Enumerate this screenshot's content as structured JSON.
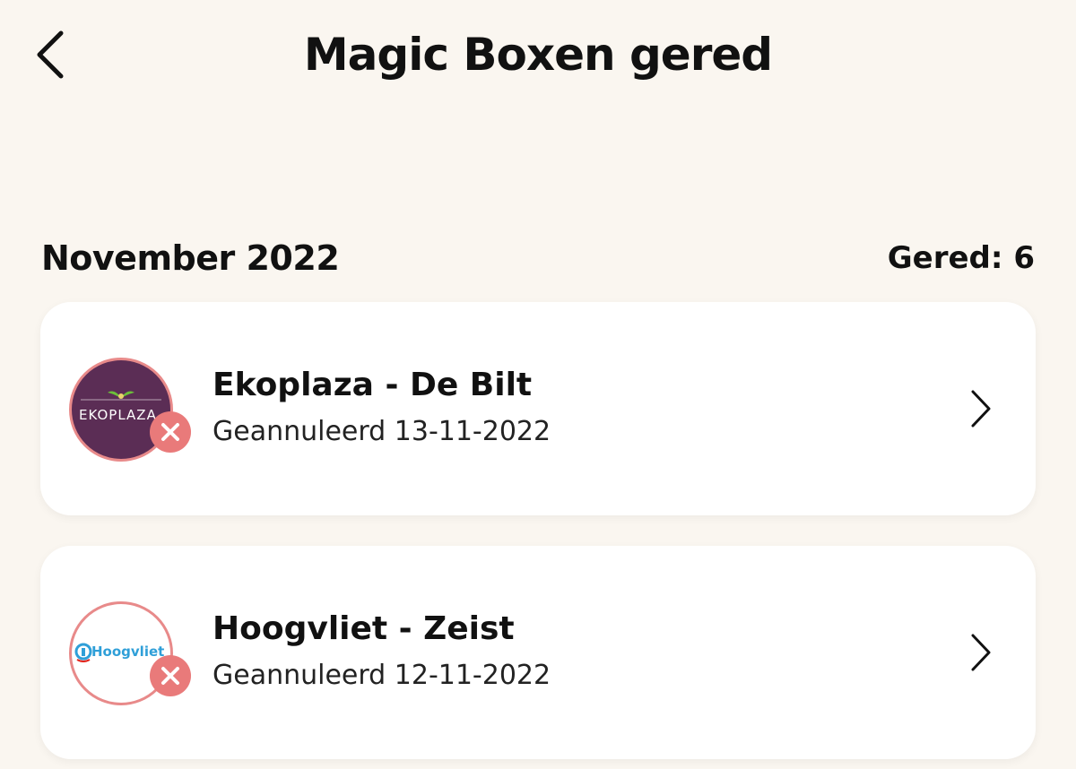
{
  "header": {
    "title": "Magic Boxen gered",
    "back_icon": "chevron-left-icon"
  },
  "section": {
    "month": "November 2022",
    "count_label": "Gered: 6"
  },
  "items": [
    {
      "store": "Ekoplaza - De Bilt",
      "status": "Geannuleerd 13-11-2022",
      "logo_text": "EKOPLAZA",
      "logo_color": "#5b2d55",
      "badge_icon": "cancel-x-icon",
      "chevron_icon": "chevron-right-icon"
    },
    {
      "store": "Hoogvliet - Zeist",
      "status": "Geannuleerd 12-11-2022",
      "logo_text": "Hoogvliet",
      "logo_color": "#2f9fd8",
      "badge_icon": "cancel-x-icon",
      "chevron_icon": "chevron-right-icon"
    }
  ],
  "colors": {
    "background": "#faf6f0",
    "card": "#ffffff",
    "cancel_badge": "#e97a7a",
    "logo_ring": "#e88a8a"
  }
}
